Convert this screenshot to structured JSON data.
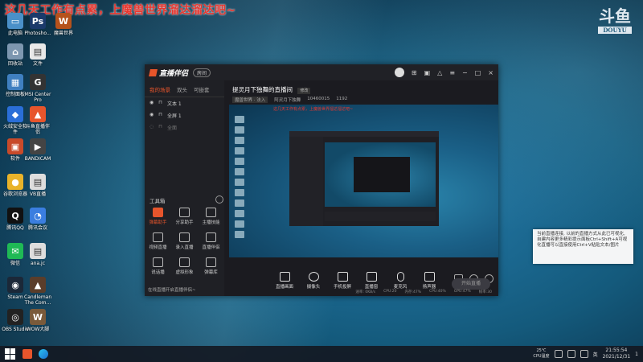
{
  "banner_text": "这几天工作有点累，上魔兽世界溜达溜达吧~",
  "overlay_logo": {
    "main": "斗鱼",
    "sub": "DOUYU"
  },
  "desktop_icons": [
    {
      "label": "此电脑",
      "color": "#4a90c8",
      "glyph": "▭"
    },
    {
      "label": "Photosho...",
      "color": "#1b3a6b",
      "glyph": "Ps"
    },
    {
      "label": "魔兽世界",
      "color": "#b5521c",
      "glyph": "W"
    },
    {
      "label": "回收站",
      "color": "#7d97b0",
      "glyph": "⌂"
    },
    {
      "label": "文件",
      "color": "#e8e8e8",
      "glyph": "▤"
    },
    {
      "label": "控制面板",
      "color": "#3f7fc0",
      "glyph": "▦"
    },
    {
      "label": "MSI Center Pro",
      "color": "#333",
      "glyph": "G"
    },
    {
      "label": "火绒安全软件",
      "color": "#2a6ed8",
      "glyph": "◆"
    },
    {
      "label": "斗鱼直播伴侣",
      "color": "#e7552c",
      "glyph": "▲"
    },
    {
      "label": "软件",
      "color": "#c84a2a",
      "glyph": "▣"
    },
    {
      "label": "BANDICAM",
      "color": "#444",
      "glyph": "▶"
    },
    {
      "label": "谷歌浏览器",
      "color": "#e9b32a",
      "glyph": "●"
    },
    {
      "label": "VB直播",
      "color": "#ddd",
      "glyph": "▤"
    },
    {
      "label": "腾讯QQ",
      "color": "#111",
      "glyph": "Q"
    },
    {
      "label": "腾讯会议",
      "color": "#3b7ee0",
      "glyph": "◔"
    },
    {
      "label": "微信",
      "color": "#1fb955",
      "glyph": "✉"
    },
    {
      "label": "ana.jc",
      "color": "#ddd",
      "glyph": "▤"
    },
    {
      "label": "Steam",
      "color": "#1b2838",
      "glyph": "◉"
    },
    {
      "label": "Candleman The Com...",
      "color": "#5a3d2a",
      "glyph": "▲"
    },
    {
      "label": "OBS Studio",
      "color": "#222",
      "glyph": "◎"
    },
    {
      "label": "WOW大脚",
      "color": "#7a5a3a",
      "glyph": "W"
    }
  ],
  "app": {
    "brand": "直播伴侣",
    "pill": "房间",
    "left_tabs": [
      "我的场景",
      "双头",
      "可嵌套"
    ],
    "layers": [
      {
        "name": "文本 1"
      },
      {
        "name": "全屏 1"
      },
      {
        "name": "全面"
      }
    ],
    "tools_title": "工具箱",
    "tools": [
      {
        "label": "弹幕助手",
        "hot": true
      },
      {
        "label": "分享助手",
        "hot": false
      },
      {
        "label": "主播技能",
        "hot": false
      },
      {
        "label": "视频直播",
        "hot": false
      },
      {
        "label": "录入直播",
        "hot": false
      },
      {
        "label": "直播伴侣",
        "hot": false
      },
      {
        "label": "说话播",
        "hot": false
      },
      {
        "label": "虚拟形象",
        "hot": false
      },
      {
        "label": "弹幕库",
        "hot": false
      }
    ],
    "left_footer": "在线直播开启直播伴侣~",
    "stream_title": "提灵月下独舞的直播间",
    "stream_tag": "修改",
    "meta": [
      "魔兽世界 · 法入",
      "阿灵月下独舞",
      "10460015",
      "1192"
    ],
    "preview_banner": "这几天工作有点累，上魔兽世界溜达溜达吧~",
    "tooltip": "当前直播连接, 以前的直播方式从此已可视化, 自建内容更多精彩提示面板Ctrl+Shift+A可视化直播可以直接使用Ctrl+V粘贴文本/图片",
    "bottom_tools": [
      "直播画面",
      "摄像头",
      "手机投屏",
      "直播窗",
      "麦克风",
      "扬声器"
    ],
    "go_live": "开始直播",
    "status_items": [
      "速率: 0KB/s",
      "CPU:20",
      "内存:47%",
      "CPU:40%",
      "GPU:47%",
      "帧率:30"
    ]
  },
  "taskbar": {
    "weather": {
      "temp": "25℃",
      "desc": "CPU温度"
    },
    "time": "21:55:54",
    "date": "2021/12/31",
    "input_method": "英",
    "counter": "1"
  }
}
